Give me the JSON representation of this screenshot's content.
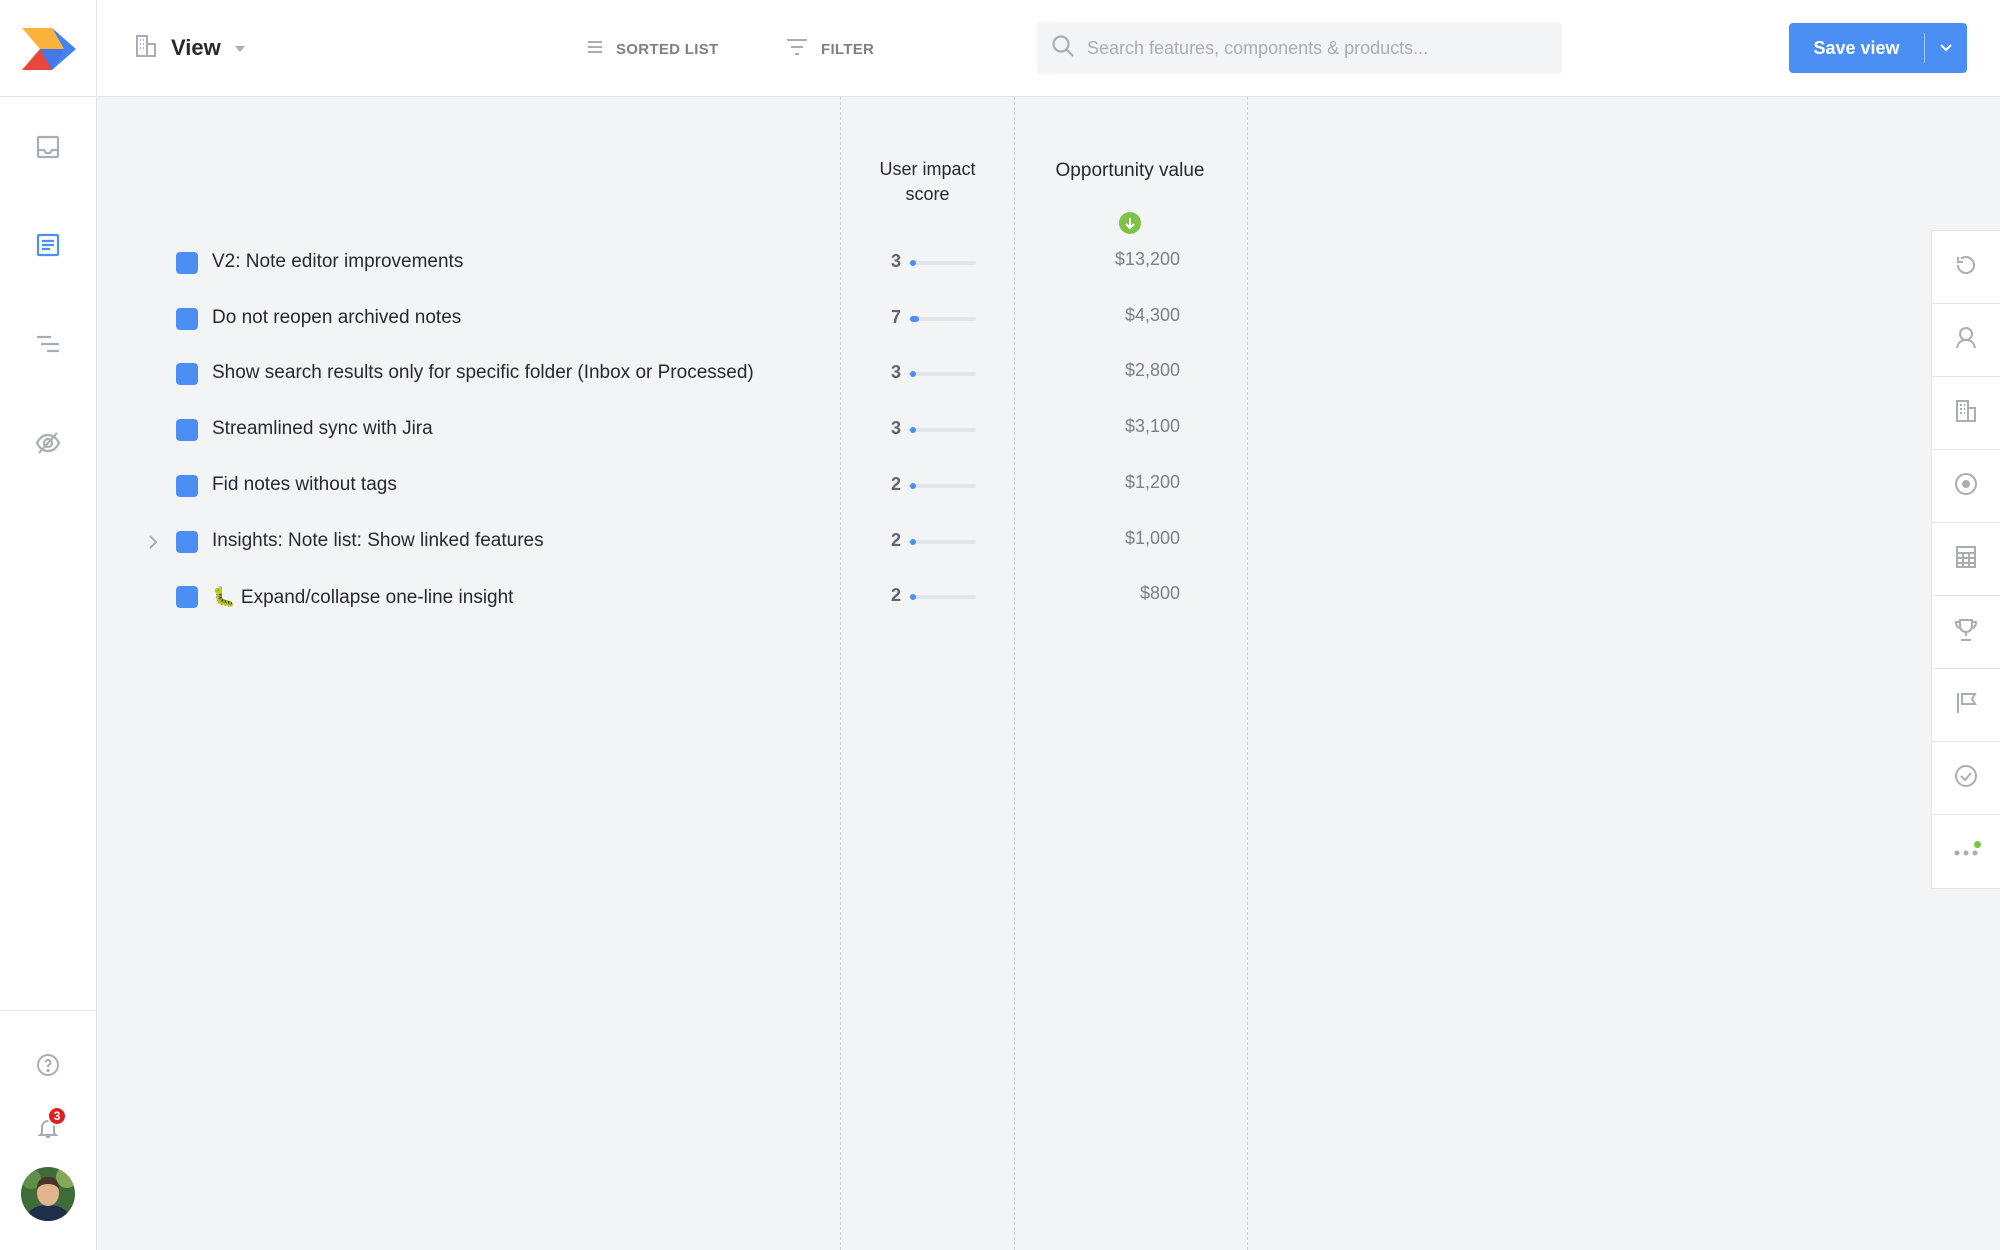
{
  "topbar": {
    "view_label": "View",
    "sorted_list_label": "SORTED LIST",
    "filter_label": "FILTER",
    "search_placeholder": "Search features, components & products...",
    "save_label": "Save view"
  },
  "sidebar": {
    "items": [
      {
        "name": "inbox-icon"
      },
      {
        "name": "features-board-icon",
        "active": true
      },
      {
        "name": "roadmap-icon"
      },
      {
        "name": "insights-icon"
      }
    ],
    "notifications_count": "3"
  },
  "columns": {
    "impact_header": "User impact score",
    "opportunity_header": "Opportunity value"
  },
  "rows": [
    {
      "title": "V2: Note editor improvements",
      "score": "3",
      "score_fraction": 0.03,
      "opportunity": "$13,200",
      "expandable": false
    },
    {
      "title": "Do not reopen archived notes",
      "score": "7",
      "score_fraction": 0.13,
      "opportunity": "$4,300",
      "expandable": false
    },
    {
      "title": "Show search results only for specific folder (Inbox or Processed)",
      "score": "3",
      "score_fraction": 0.03,
      "opportunity": "$2,800",
      "expandable": false
    },
    {
      "title": "Streamlined sync with Jira",
      "score": "3",
      "score_fraction": 0.03,
      "opportunity": "$3,100",
      "expandable": false
    },
    {
      "title": "Fid notes without tags",
      "score": "2",
      "score_fraction": 0.02,
      "opportunity": "$1,200",
      "expandable": false
    },
    {
      "title": "Insights: Note list: Show linked features",
      "score": "2",
      "score_fraction": 0.02,
      "opportunity": "$1,000",
      "expandable": true
    },
    {
      "title": "🐛 Expand/collapse one-line insight",
      "score": "2",
      "score_fraction": 0.02,
      "opportunity": "$800",
      "expandable": false
    }
  ],
  "right_panel": [
    {
      "name": "history-icon"
    },
    {
      "name": "user-icon"
    },
    {
      "name": "company-icon"
    },
    {
      "name": "target-icon"
    },
    {
      "name": "calculator-icon"
    },
    {
      "name": "trophy-icon"
    },
    {
      "name": "flag-icon"
    },
    {
      "name": "check-circle-icon"
    },
    {
      "name": "more-icon"
    }
  ],
  "colors": {
    "accent": "#4b8ff5",
    "sort_indicator": "#7ec247",
    "badge": "#e02020"
  }
}
